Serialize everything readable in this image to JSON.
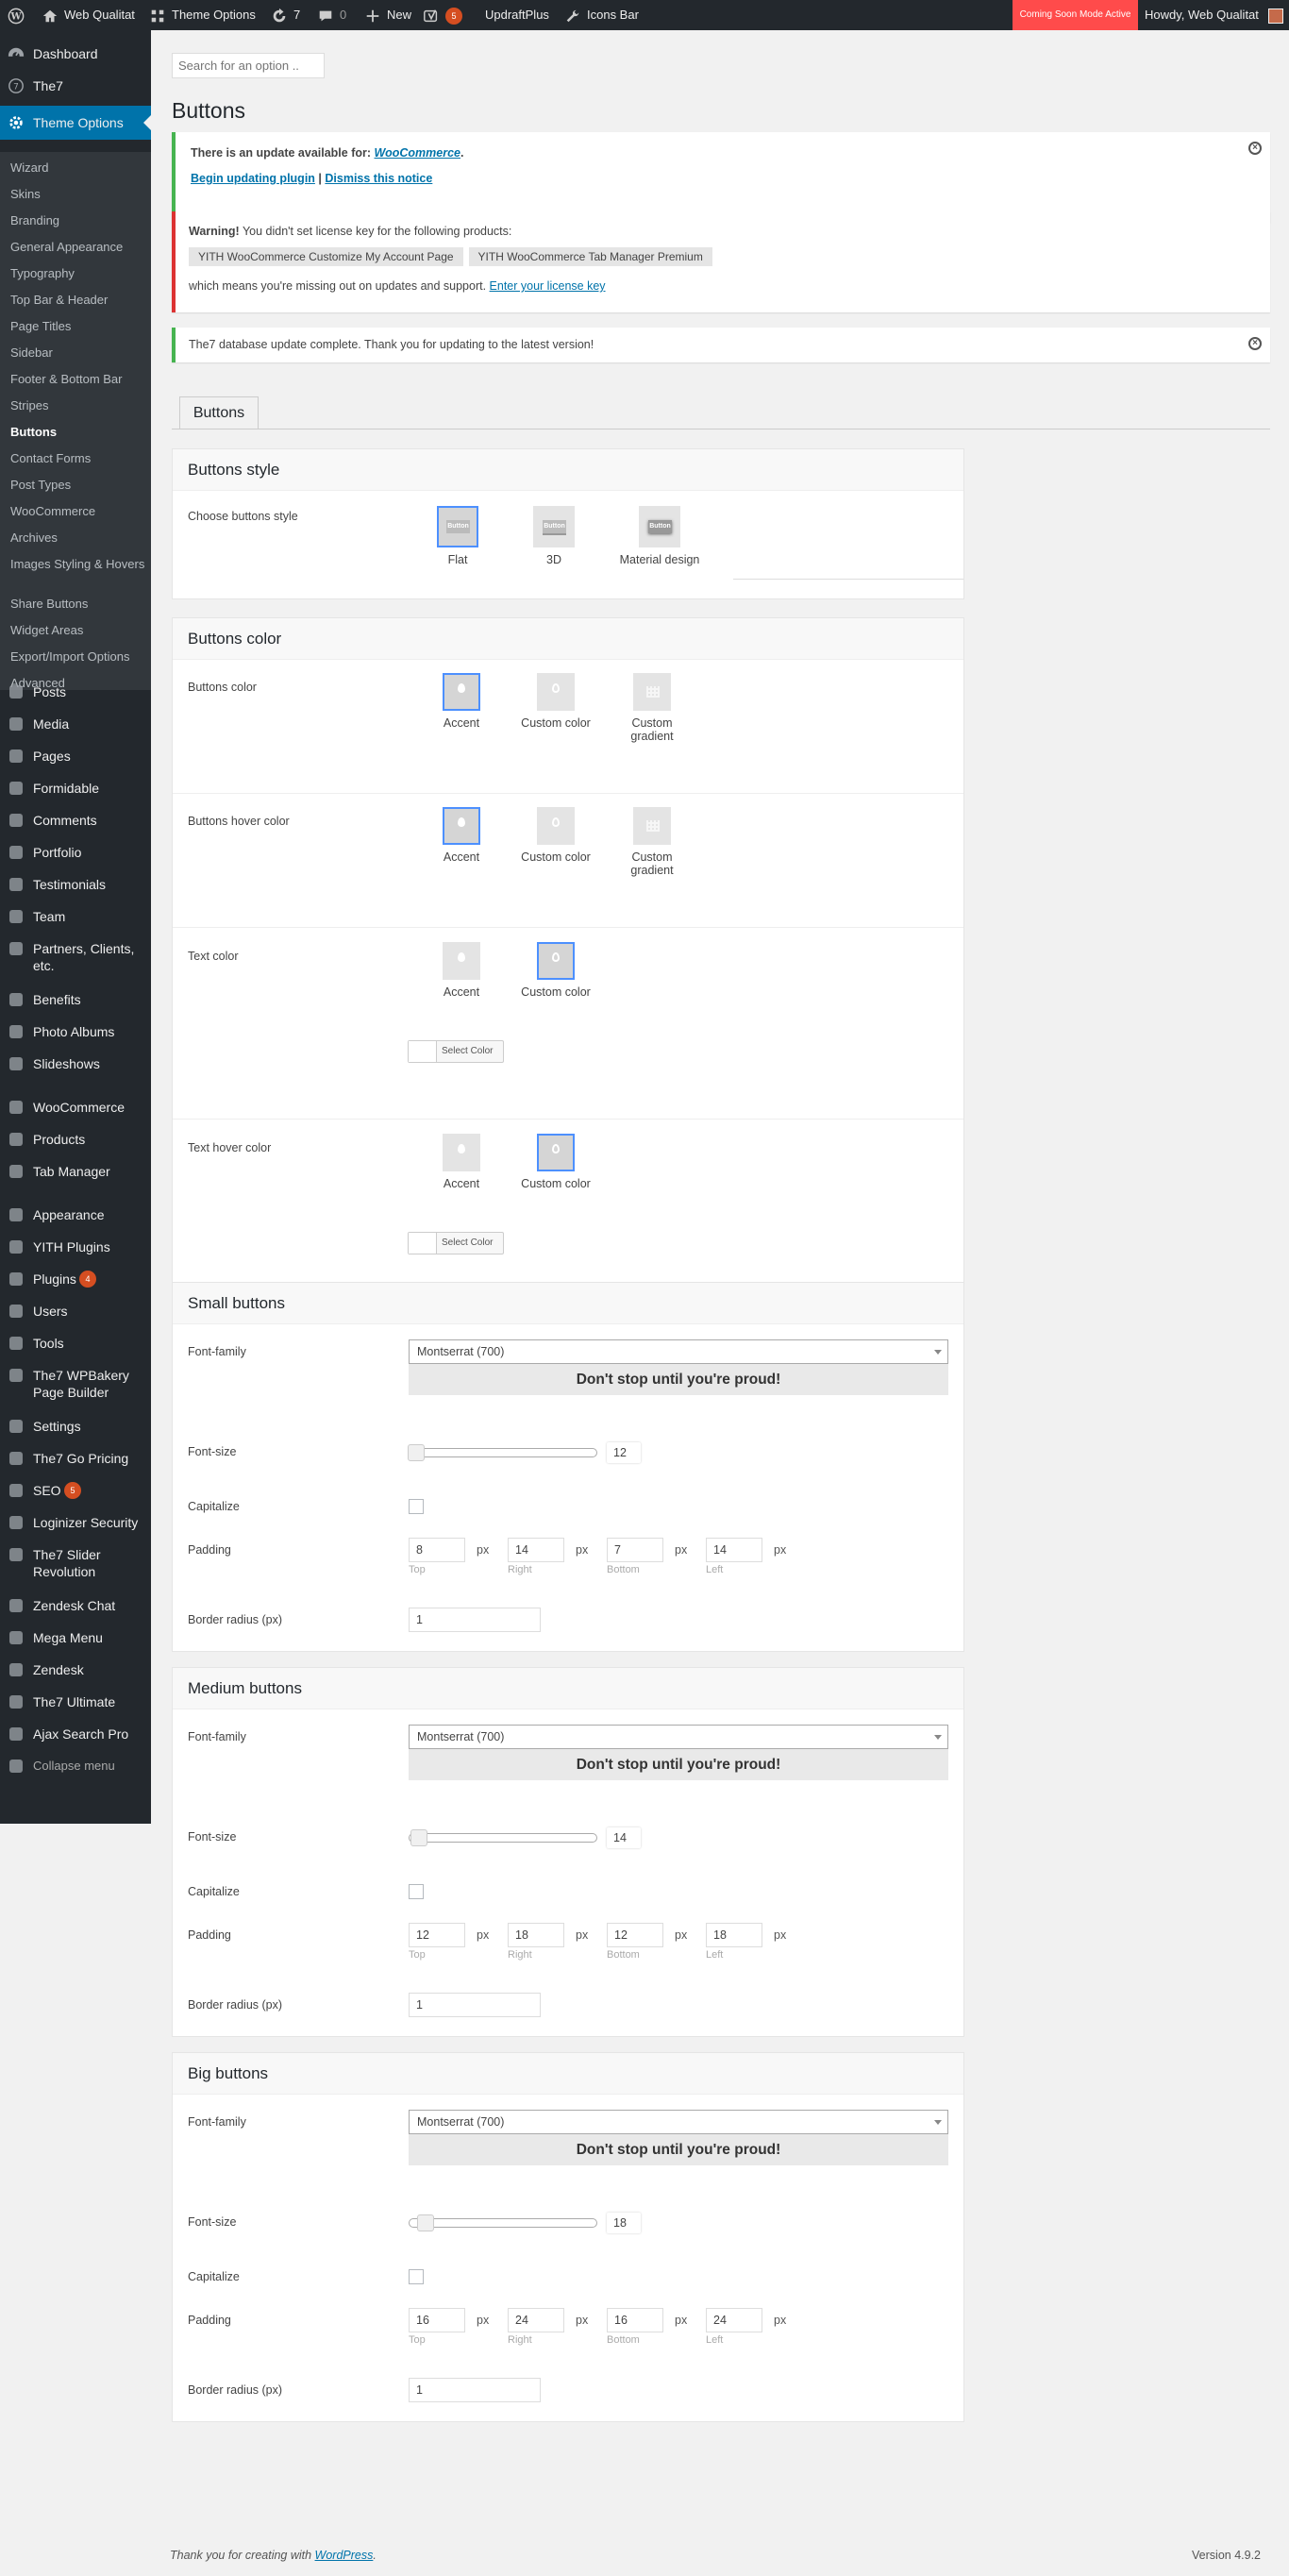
{
  "admin_bar": {
    "site_name": "Web Qualitat",
    "theme_options": "Theme Options",
    "updates_count": "7",
    "comments_count": "0",
    "new_label": "New",
    "seo_count": "5",
    "updraft": "UpdraftPlus",
    "icons_bar": "Icons Bar",
    "coming_soon": "Coming Soon Mode Active",
    "howdy": "Howdy, Web Qualitat"
  },
  "sidebar": {
    "top_items": [
      {
        "label": "Dashboard",
        "icon": "dashboard-icon"
      },
      {
        "label": "The7",
        "icon": "the7-icon"
      },
      {
        "label": "Theme Options",
        "icon": "gear-icon"
      }
    ],
    "submenu": [
      "Wizard",
      "Skins",
      "Branding",
      "General Appearance",
      "Typography",
      "Top Bar & Header",
      "Page Titles",
      "Sidebar",
      "Footer & Bottom Bar",
      "Stripes",
      "Buttons",
      "Contact Forms",
      "Post Types",
      "WooCommerce",
      "Archives",
      "Images Styling & Hovers",
      "Share Buttons",
      "Widget Areas",
      "Export/Import Options",
      "Advanced"
    ],
    "items": [
      {
        "label": "Posts",
        "icon": "pin-icon"
      },
      {
        "label": "Media",
        "icon": "media-icon"
      },
      {
        "label": "Pages",
        "icon": "pages-icon"
      },
      {
        "label": "Formidable",
        "icon": "formidable-icon"
      },
      {
        "label": "Comments",
        "icon": "comments-icon"
      },
      {
        "label": "Portfolio",
        "icon": "portfolio-icon"
      },
      {
        "label": "Testimonials",
        "icon": "testimonials-icon"
      },
      {
        "label": "Team",
        "icon": "team-icon"
      },
      {
        "label": "Partners, Clients, etc.",
        "icon": "partners-icon"
      },
      {
        "label": "Benefits",
        "icon": "benefits-icon"
      },
      {
        "label": "Photo Albums",
        "icon": "photo-icon"
      },
      {
        "label": "Slideshows",
        "icon": "slideshow-icon"
      },
      {
        "label": "WooCommerce",
        "icon": "woo-icon"
      },
      {
        "label": "Products",
        "icon": "products-icon"
      },
      {
        "label": "Tab Manager",
        "icon": "tab-manager-icon"
      },
      {
        "label": "Appearance",
        "icon": "brush-icon"
      },
      {
        "label": "YITH Plugins",
        "icon": "yith-icon"
      },
      {
        "label": "Plugins",
        "icon": "plugin-icon",
        "badge": "4"
      },
      {
        "label": "Users",
        "icon": "users-icon"
      },
      {
        "label": "Tools",
        "icon": "tools-icon"
      },
      {
        "label": "The7 WPBakery Page Builder",
        "icon": "builder-icon"
      },
      {
        "label": "Settings",
        "icon": "settings-icon"
      },
      {
        "label": "The7 Go Pricing",
        "icon": "pricing-icon"
      },
      {
        "label": "SEO",
        "icon": "seo-icon",
        "badge": "5"
      },
      {
        "label": "Loginizer Security",
        "icon": "security-icon"
      },
      {
        "label": "The7 Slider Revolution",
        "icon": "slider-icon"
      },
      {
        "label": "Zendesk Chat",
        "icon": "chat-icon"
      },
      {
        "label": "Mega Menu",
        "icon": "menu-icon"
      },
      {
        "label": "Zendesk",
        "icon": "zendesk-icon"
      },
      {
        "label": "The7 Ultimate",
        "icon": "ultimate-icon"
      },
      {
        "label": "Ajax Search Pro",
        "icon": "search-icon"
      },
      {
        "label": "Collapse menu",
        "icon": "collapse-icon"
      }
    ]
  },
  "search_placeholder": "Search for an option ..",
  "page_title": "Buttons",
  "notices": {
    "update_text": "There is an update available for: ",
    "update_link": "WooCommerce",
    "begin_update": "Begin updating plugin",
    "divider": "|",
    "dismiss": "Dismiss this notice",
    "warning_bold": "Warning!",
    "warning_text": " You didn't set license key for the following products:",
    "products": [
      "YITH WooCommerce Customize My Account Page",
      "YITH WooCommerce Tab Manager Premium"
    ],
    "missing_text": "which means you're missing out on updates and support. ",
    "license_link": "Enter your license key",
    "db_text": "The7 database update complete. Thank you for updating to the latest version!"
  },
  "tab_label": "Buttons",
  "style_box": {
    "title": "Buttons style",
    "label": "Choose buttons style",
    "btn_text": "Button",
    "options": [
      "Flat",
      "3D",
      "Material design"
    ]
  },
  "color_box": {
    "title": "Buttons color",
    "buttons_color": "Buttons color",
    "hover_color": "Buttons hover color",
    "text_color": "Text color",
    "text_hover_color": "Text hover color",
    "accent": "Accent",
    "custom": "Custom color",
    "gradient": "Custom gradient",
    "select_color": "Select Color"
  },
  "sizes": [
    {
      "title": "Small buttons",
      "font": "Montserrat (700)",
      "preview": "Don't stop until you're proud!",
      "font_size": "12",
      "font_size_value": 12,
      "padding": [
        "8",
        "14",
        "7",
        "14"
      ]
    },
    {
      "title": "Medium buttons",
      "font": "Montserrat (700)",
      "preview": "Don't stop until you're proud!",
      "font_size": "14",
      "font_size_value": 14,
      "padding": [
        "12",
        "18",
        "12",
        "18"
      ]
    },
    {
      "title": "Big buttons",
      "font": "Montserrat (700)",
      "preview": "Don't stop until you're proud!",
      "font_size": "18",
      "font_size_value": 18,
      "padding": [
        "16",
        "24",
        "16",
        "24"
      ]
    }
  ],
  "size_labels": {
    "font_family": "Font-family",
    "font_size": "Font-size",
    "capitalize": "Capitalize",
    "padding": "Padding",
    "border_radius": "Border radius (px)",
    "radius_value": "1",
    "px": "px",
    "captions": [
      "Top",
      "Right",
      "Bottom",
      "Left"
    ]
  },
  "footer": {
    "thanks": "Thank you for creating with ",
    "wp": "WordPress",
    "dot": ".",
    "version": "Version 4.9.2"
  },
  "colors": {
    "accent": "#0073aa",
    "sidebar": "#23282d",
    "coming_soon": "#ff4b4b",
    "selected": "#4d90fe"
  }
}
